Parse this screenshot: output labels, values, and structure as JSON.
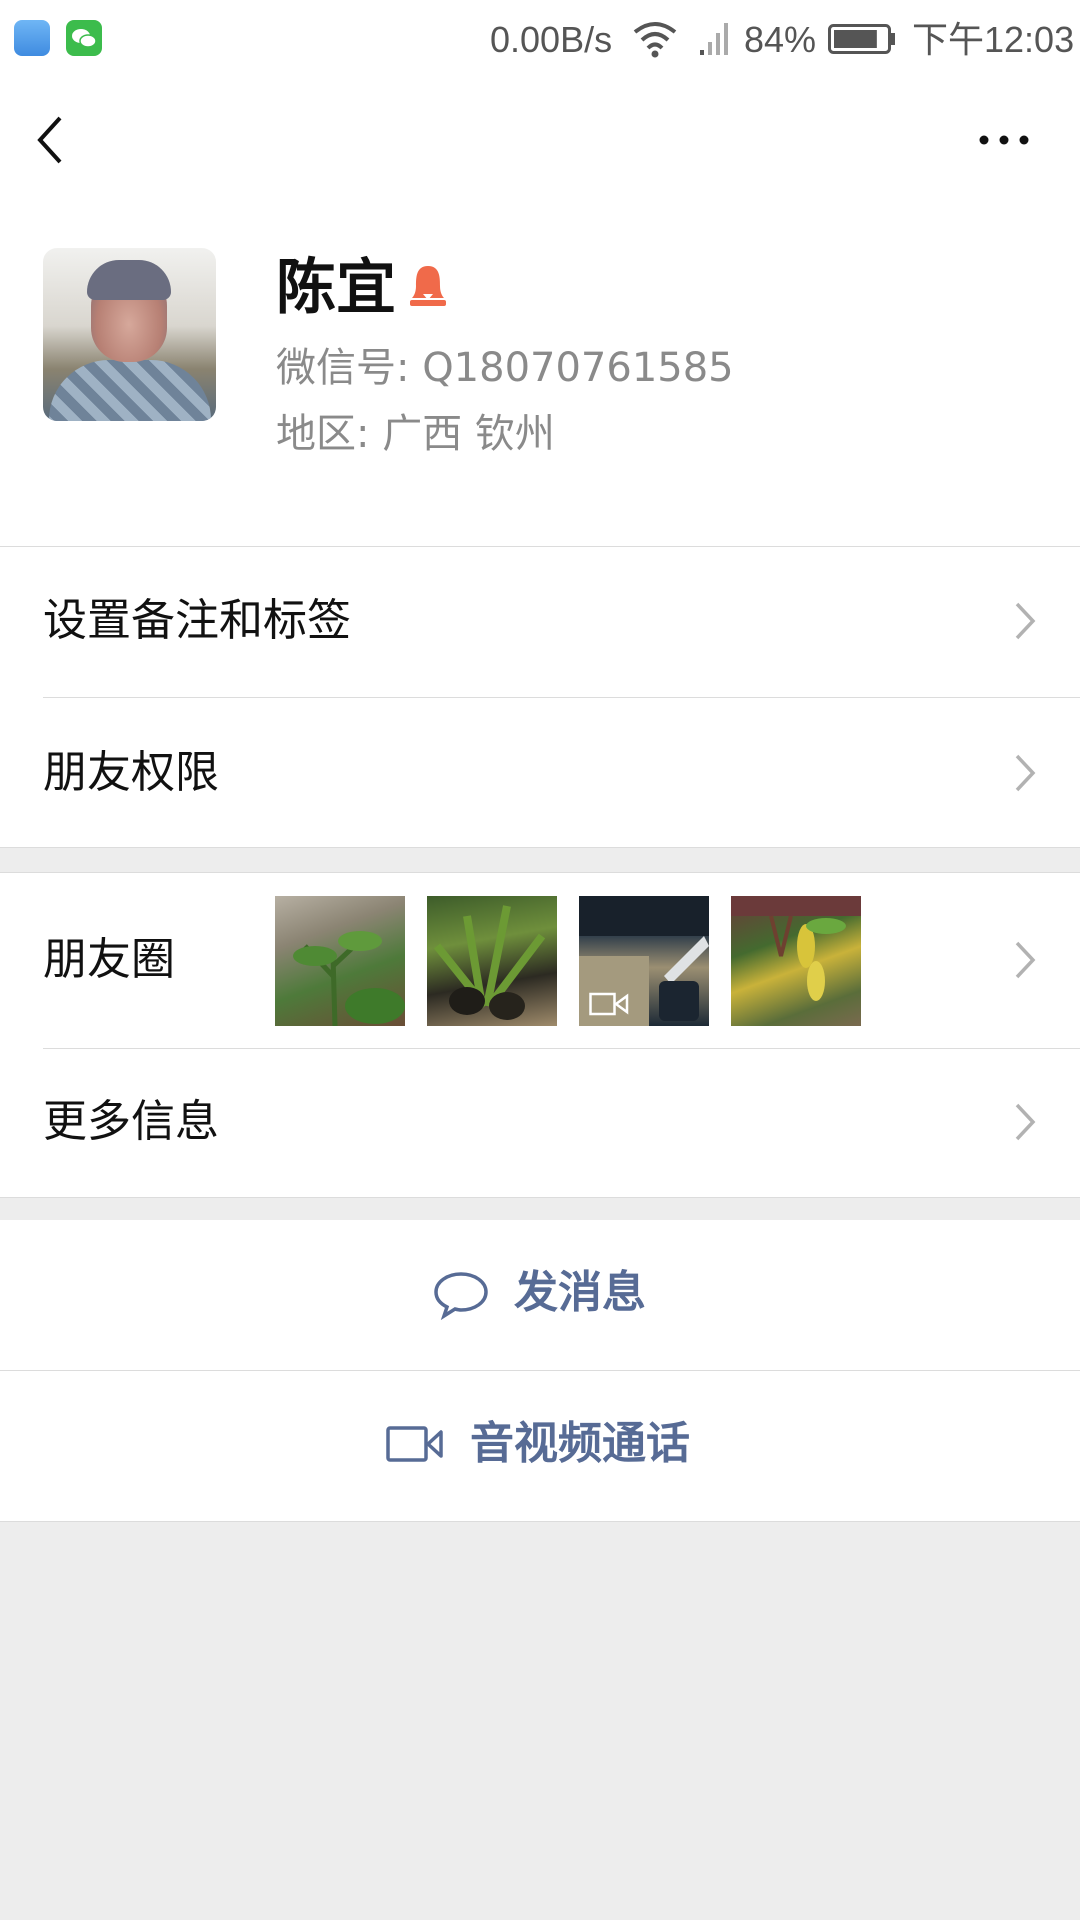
{
  "status_bar": {
    "network_speed": "0.00B/s",
    "battery_percent": "84%",
    "time": "下午12:03",
    "battery_level": 0.84
  },
  "nav": {
    "back_icon": "back-chevron-icon",
    "more_icon": "more-dots-icon"
  },
  "profile": {
    "name": "陈宜",
    "gender_icon": "female-icon",
    "wechat_id": "微信号:  Q18070761585",
    "region": "地区:  广西  钦州"
  },
  "menu": {
    "remark_tags": "设置备注和标签",
    "friend_permissions": "朋友权限",
    "moments": "朋友圈",
    "more_info": "更多信息"
  },
  "actions": {
    "send_message": "发消息",
    "video_call": "音视频通话"
  },
  "colors": {
    "accent_link": "#576b95",
    "background": "#ededed",
    "gender_female": "#f06a4a"
  }
}
